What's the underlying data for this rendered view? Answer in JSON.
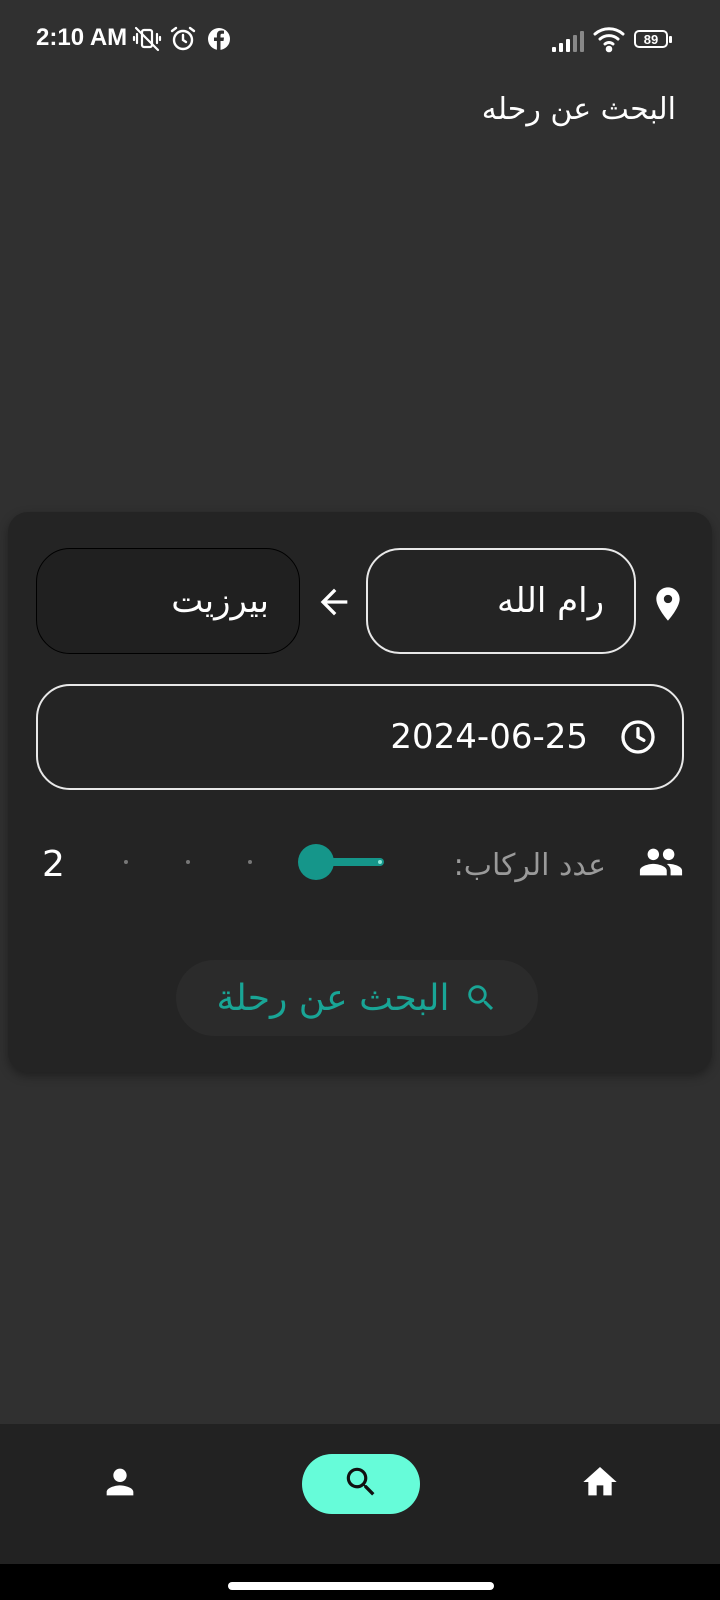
{
  "status_bar": {
    "time": "2:10 AM",
    "icons": [
      "mute-vibrate-icon",
      "alarm-icon",
      "facebook-icon",
      "signal-icon",
      "wifi-icon",
      "battery-icon"
    ],
    "battery_level": "89"
  },
  "header": {
    "title": "البحث عن رحله"
  },
  "search_form": {
    "from_value": "رام الله",
    "to_value": "بيرزيت",
    "date_value": "2024-06-25",
    "passengers_label": "عدد الركاب:",
    "passengers_count": "2",
    "passengers_slider": {
      "value": 2,
      "min": 1,
      "max": 5
    },
    "search_button_label": "البحث عن رحلة"
  },
  "bottom_nav": {
    "items": [
      {
        "icon": "home-icon",
        "selected": false
      },
      {
        "icon": "search-icon",
        "selected": true
      },
      {
        "icon": "person-icon",
        "selected": false
      }
    ]
  },
  "colors": {
    "background": "#303030",
    "card": "#242424",
    "accent": "#15968a",
    "nav_active": "#66fcd9"
  }
}
